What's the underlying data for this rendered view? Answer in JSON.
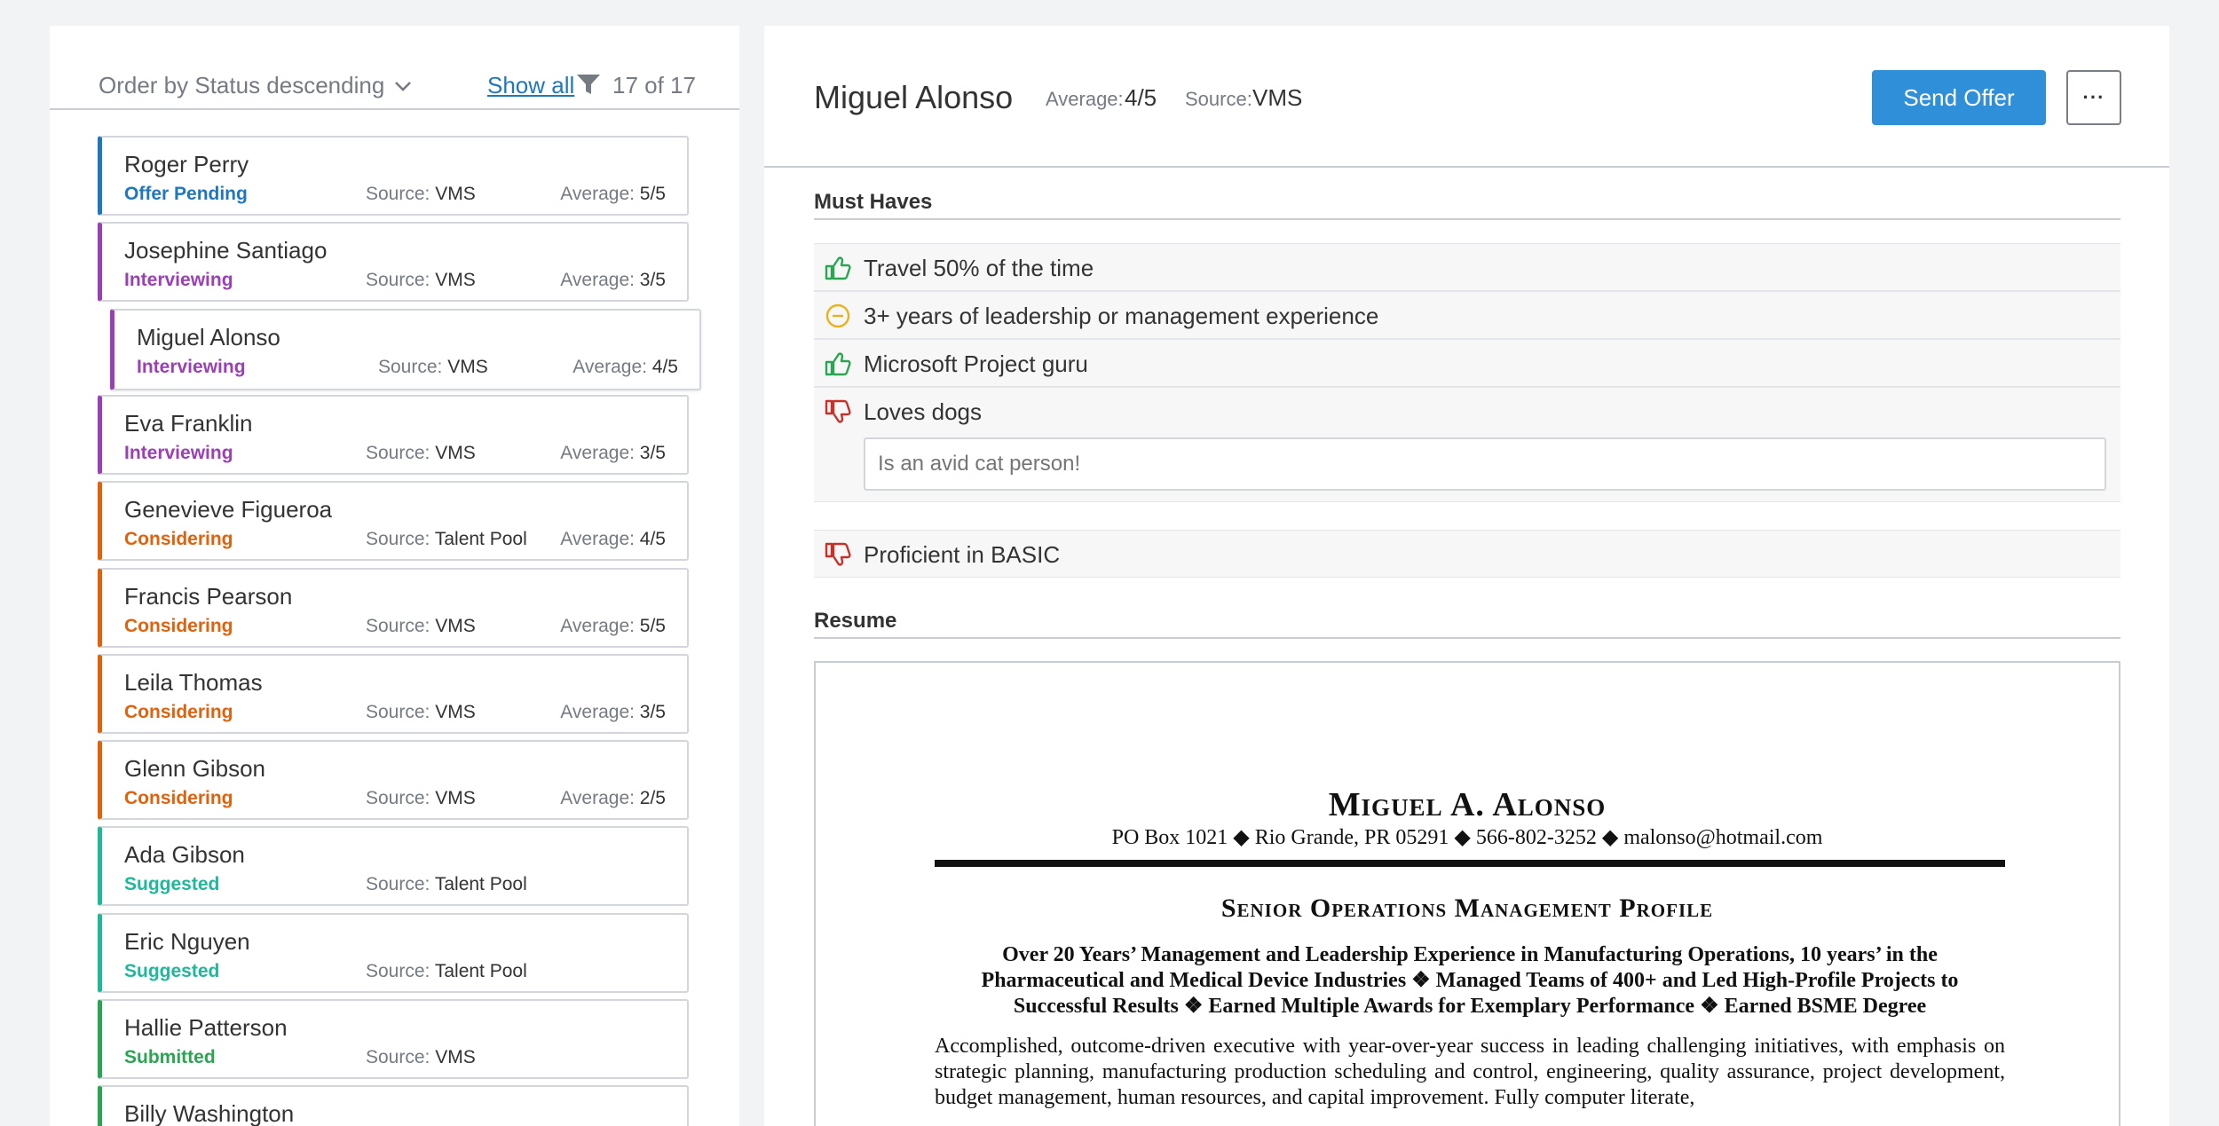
{
  "list": {
    "order_by": "Order by Status descending",
    "show_all": "Show all",
    "count": "17 of 17",
    "source_label": "Source:",
    "average_label": "Average:",
    "candidates": [
      {
        "name": "Roger Perry",
        "status": "Offer Pending",
        "source": "VMS",
        "average": "5/5",
        "color": "#1f78bf"
      },
      {
        "name": "Josephine Santiago",
        "status": "Interviewing",
        "source": "VMS",
        "average": "3/5",
        "color": "#9b3fb5"
      },
      {
        "name": "Miguel Alonso",
        "status": "Interviewing",
        "source": "VMS",
        "average": "4/5",
        "color": "#9b3fb5",
        "selected": true
      },
      {
        "name": "Eva Franklin",
        "status": "Interviewing",
        "source": "VMS",
        "average": "3/5",
        "color": "#9b3fb5"
      },
      {
        "name": "Genevieve Figueroa",
        "status": "Considering",
        "source": "Talent Pool",
        "average": "4/5",
        "color": "#e0620d"
      },
      {
        "name": "Francis Pearson",
        "status": "Considering",
        "source": "VMS",
        "average": "5/5",
        "color": "#e0620d"
      },
      {
        "name": "Leila Thomas",
        "status": "Considering",
        "source": "VMS",
        "average": "3/5",
        "color": "#e0620d"
      },
      {
        "name": "Glenn Gibson",
        "status": "Considering",
        "source": "VMS",
        "average": "2/5",
        "color": "#e0620d"
      },
      {
        "name": "Ada Gibson",
        "status": "Suggested",
        "source": "Talent Pool",
        "average": "",
        "color": "#1fb89a"
      },
      {
        "name": "Eric Nguyen",
        "status": "Suggested",
        "source": "Talent Pool",
        "average": "",
        "color": "#1fb89a"
      },
      {
        "name": "Hallie Patterson",
        "status": "Submitted",
        "source": "VMS",
        "average": "",
        "color": "#2aa551"
      },
      {
        "name": "Billy Washington",
        "status": "",
        "source": "",
        "average": "",
        "color": "#2aa551"
      }
    ]
  },
  "detail": {
    "name": "Miguel Alonso",
    "average_label": "Average:",
    "average": "4/5",
    "source_label": "Source:",
    "source": "VMS",
    "send_offer": "Send Offer",
    "more": "···",
    "must_haves_title": "Must Haves",
    "must_haves": [
      {
        "text": "Travel 50% of the time",
        "icon": "thumbs-up-icon"
      },
      {
        "text": "3+ years of leadership or management experience",
        "icon": "neutral-icon"
      },
      {
        "text": "Microsoft Project guru",
        "icon": "thumbs-up-icon"
      },
      {
        "text": "Loves dogs",
        "icon": "thumbs-down-icon",
        "comment_placeholder": "Is an avid cat person!"
      },
      {
        "text": "Proficient in BASIC",
        "icon": "thumbs-down-icon"
      }
    ],
    "resume_title": "Resume",
    "resume": {
      "name": "Miguel A. Alonso",
      "contact": "PO Box 1021 ◆ Rio Grande, PR 05291 ◆ 566-802-3252 ◆ malonso@hotmail.com",
      "profile_title": "Senior Operations Management Profile",
      "summary": "Over 20 Years’ Management and Leadership Experience in Manufacturing Operations, 10 years’ in the Pharmaceutical and Medical Device Industries ❖ Managed Teams of 400+ and Led High-Profile Projects to Successful Results ❖ Earned Multiple Awards for Exemplary Performance ❖ Earned BSME Degree",
      "body": "Accomplished, outcome-driven executive with year-over-year success in leading challenging initiatives, with emphasis on strategic planning, manufacturing production scheduling and control, engineering, quality assurance, project development, budget management, human resources, and capital improvement. Fully computer literate,"
    }
  },
  "colors": {
    "accent": "#2f8fd8",
    "thumbs_up": "#2aa551",
    "neutral": "#e8b21c",
    "thumbs_down": "#c8312a"
  }
}
